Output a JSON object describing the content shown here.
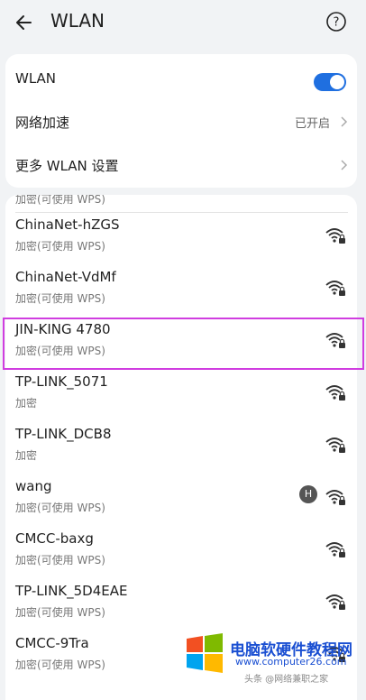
{
  "header": {
    "title": "WLAN"
  },
  "settings": {
    "wlan_label": "WLAN",
    "wlan_enabled": true,
    "accel_label": "网络加速",
    "accel_value": "已开启",
    "more_label": "更多 WLAN 设置"
  },
  "list": {
    "partial_text": "加密(可使用 WPS)",
    "networks": [
      {
        "name": "ChinaNet-hZGS",
        "security": "加密(可使用 WPS)"
      },
      {
        "name": "ChinaNet-VdMf",
        "security": "加密(可使用 WPS)"
      },
      {
        "name": "JIN-KING 4780",
        "security": "加密(可使用 WPS)"
      },
      {
        "name": "TP-LINK_5071",
        "security": "加密"
      },
      {
        "name": "TP-LINK_DCB8",
        "security": "加密"
      },
      {
        "name": "wang",
        "security": "加密(可使用 WPS)"
      },
      {
        "name": "CMCC-baxg",
        "security": "加密(可使用 WPS)"
      },
      {
        "name": "TP-LINK_5D4EAE",
        "security": "加密(可使用 WPS)"
      },
      {
        "name": "CMCC-9Tra",
        "security": "加密(可使用 WPS)"
      }
    ]
  },
  "watermark": {
    "brand": "电脑软硬件教程网",
    "url": "www.computer26.com",
    "credit": "头条 @网络兼职之家"
  },
  "colors": {
    "accent": "#1f6fe0",
    "highlight": "#d03de0"
  }
}
